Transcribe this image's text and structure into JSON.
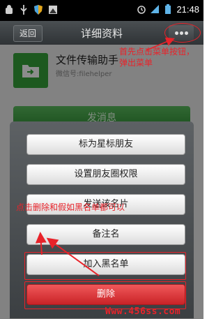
{
  "status_bar": {
    "time": "21:48",
    "left_icons": [
      "android-debug-icon",
      "usb-icon",
      "shield-icon",
      "image-icon"
    ],
    "right_icons": [
      "alarm-icon",
      "signal-icon",
      "battery-icon"
    ]
  },
  "title_bar": {
    "back_label": "返回",
    "title": "详细资料"
  },
  "profile": {
    "name": "文件传输助手",
    "wechat_id": "微信号:filehelper"
  },
  "send_button_label": "发消息",
  "menu": {
    "items": [
      {
        "label": "标为星标朋友"
      },
      {
        "label": "设置朋友圈权限"
      },
      {
        "label": "发送该名片"
      },
      {
        "label": "备注名"
      },
      {
        "label": "加入黑名单"
      },
      {
        "label": "删除"
      }
    ]
  },
  "annotations": {
    "top": "首先点击菜单按钮，弹出菜单",
    "middle": "点击删除和假如黑名单都可以",
    "watermark": "Www.456ss.com"
  },
  "colors": {
    "annotation_red": "#e8232a",
    "delete_red": "#d22a2e",
    "avatar_green": "#35a33a",
    "send_green": "#3da242"
  }
}
